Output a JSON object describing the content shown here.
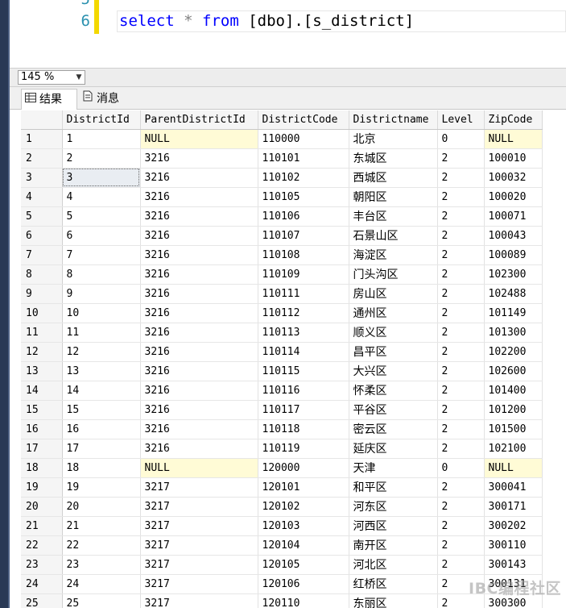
{
  "editor": {
    "lines": [
      {
        "num": "5",
        "code": ""
      },
      {
        "num": "6",
        "code": "select * from [dbo].[s_district]"
      }
    ],
    "keywords": [
      "select",
      "from"
    ],
    "operators": [
      "*"
    ],
    "tokens": {
      "select": "select",
      "star": "*",
      "from": "from",
      "rest": "[dbo].[s_district]"
    }
  },
  "zoom": {
    "value": "145 %"
  },
  "tabs": [
    {
      "label": "结果",
      "icon": "grid-icon",
      "active": true
    },
    {
      "label": "消息",
      "icon": "messages-icon",
      "active": false
    }
  ],
  "results": {
    "columns": [
      "",
      "DistrictId",
      "ParentDistrictId",
      "DistrictCode",
      "Districtname",
      "Level",
      "ZipCode"
    ],
    "rows": [
      [
        "1",
        "1",
        "NULL",
        "110000",
        "北京",
        "0",
        "NULL"
      ],
      [
        "2",
        "2",
        "3216",
        "110101",
        "东城区",
        "2",
        "100010"
      ],
      [
        "3",
        "3",
        "3216",
        "110102",
        "西城区",
        "2",
        "100032"
      ],
      [
        "4",
        "4",
        "3216",
        "110105",
        "朝阳区",
        "2",
        "100020"
      ],
      [
        "5",
        "5",
        "3216",
        "110106",
        "丰台区",
        "2",
        "100071"
      ],
      [
        "6",
        "6",
        "3216",
        "110107",
        "石景山区",
        "2",
        "100043"
      ],
      [
        "7",
        "7",
        "3216",
        "110108",
        "海淀区",
        "2",
        "100089"
      ],
      [
        "8",
        "8",
        "3216",
        "110109",
        "门头沟区",
        "2",
        "102300"
      ],
      [
        "9",
        "9",
        "3216",
        "110111",
        "房山区",
        "2",
        "102488"
      ],
      [
        "10",
        "10",
        "3216",
        "110112",
        "通州区",
        "2",
        "101149"
      ],
      [
        "11",
        "11",
        "3216",
        "110113",
        "顺义区",
        "2",
        "101300"
      ],
      [
        "12",
        "12",
        "3216",
        "110114",
        "昌平区",
        "2",
        "102200"
      ],
      [
        "13",
        "13",
        "3216",
        "110115",
        "大兴区",
        "2",
        "102600"
      ],
      [
        "14",
        "14",
        "3216",
        "110116",
        "怀柔区",
        "2",
        "101400"
      ],
      [
        "15",
        "15",
        "3216",
        "110117",
        "平谷区",
        "2",
        "101200"
      ],
      [
        "16",
        "16",
        "3216",
        "110118",
        "密云区",
        "2",
        "101500"
      ],
      [
        "17",
        "17",
        "3216",
        "110119",
        "延庆区",
        "2",
        "102100"
      ],
      [
        "18",
        "18",
        "NULL",
        "120000",
        "天津",
        "0",
        "NULL"
      ],
      [
        "19",
        "19",
        "3217",
        "120101",
        "和平区",
        "2",
        "300041"
      ],
      [
        "20",
        "20",
        "3217",
        "120102",
        "河东区",
        "2",
        "300171"
      ],
      [
        "21",
        "21",
        "3217",
        "120103",
        "河西区",
        "2",
        "300202"
      ],
      [
        "22",
        "22",
        "3217",
        "120104",
        "南开区",
        "2",
        "300110"
      ],
      [
        "23",
        "23",
        "3217",
        "120105",
        "河北区",
        "2",
        "300143"
      ],
      [
        "24",
        "24",
        "3217",
        "120106",
        "红桥区",
        "2",
        "300131"
      ],
      [
        "25",
        "25",
        "3217",
        "120110",
        "东丽区",
        "2",
        "300300"
      ]
    ],
    "selected_cell": {
      "row": 2,
      "col": 1
    }
  },
  "watermark": "IBC编程社区",
  "colors": {
    "keyword": "#0000ff",
    "line_number": "#2b91af",
    "null_cell": "#fffbd6",
    "change_bar": "#f3d800",
    "window_border": "#293955"
  }
}
